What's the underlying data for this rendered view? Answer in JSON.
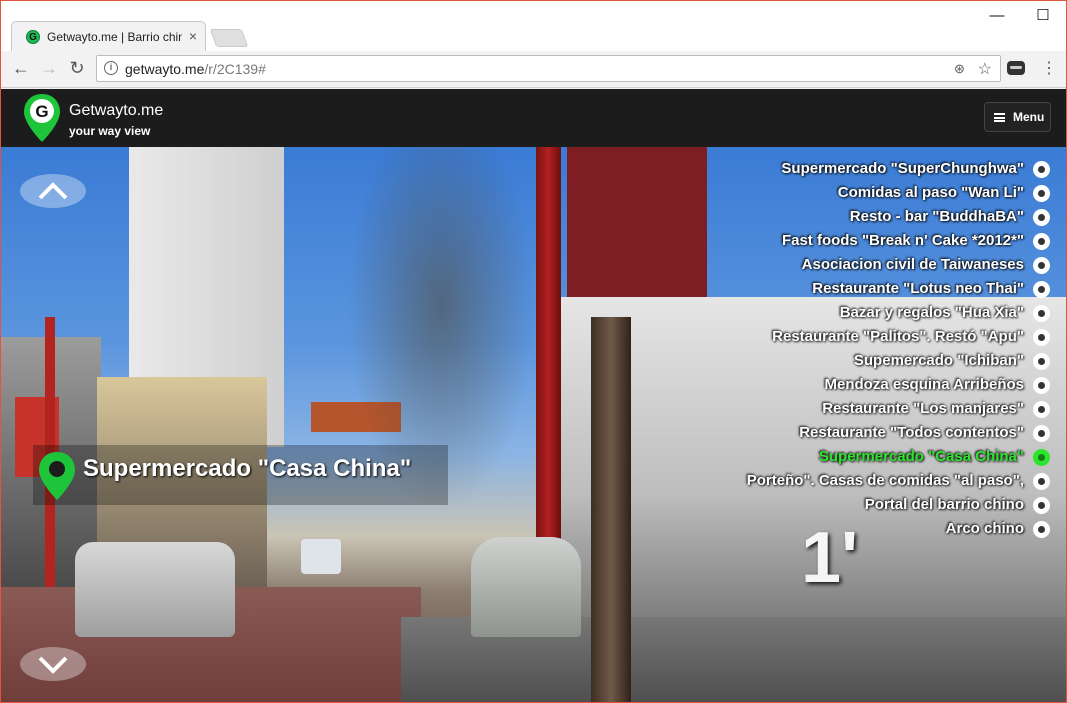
{
  "browser": {
    "tab_title": "Getwayto.me | Barrio chino",
    "tab_close": "×",
    "url_host": "getwayto.me",
    "url_path": "/r/2C139#",
    "controls": {
      "minimize": "—",
      "maximize": "☐",
      "close": "✕"
    }
  },
  "site": {
    "brand": "Getwayto.me",
    "tagline": "your way view",
    "menu_label": "Menu",
    "brand_color": "#1ec43a"
  },
  "viewer": {
    "current_place": "Supermercado \"Casa China\"",
    "time_mark": "1'",
    "poi_list": [
      {
        "label": "Supermercado \"SuperChunghwa\"",
        "active": false
      },
      {
        "label": "Comidas al paso \"Wan Li\"",
        "active": false
      },
      {
        "label": "Resto - bar \"BuddhaBA\"",
        "active": false
      },
      {
        "label": "Fast foods \"Break n' Cake *2012*\"",
        "active": false
      },
      {
        "label": "Asociacion civil de Taiwaneses",
        "active": false
      },
      {
        "label": "Restaurante \"Lotus neo Thai\"",
        "active": false
      },
      {
        "label": "Bazar y regalos \"Hua Xia\"",
        "active": false
      },
      {
        "label": "Restaurante \"Palitos\". Restó \"Apu\"",
        "active": false
      },
      {
        "label": "Supemercado \"Ichiban\"",
        "active": false
      },
      {
        "label": "Mendoza esquina Arribeños",
        "active": false
      },
      {
        "label": "Restaurante \"Los manjares\"",
        "active": false
      },
      {
        "label": "Restaurante \"Todos contentos\"",
        "active": false
      },
      {
        "label": "Supermercado \"Casa China\"",
        "active": true
      },
      {
        "label": "Porteño\". Casas de comidas \"al paso\",",
        "active": false
      },
      {
        "label": "Portal del barrio chino",
        "active": false
      },
      {
        "label": "Arco chino",
        "active": false
      }
    ]
  }
}
